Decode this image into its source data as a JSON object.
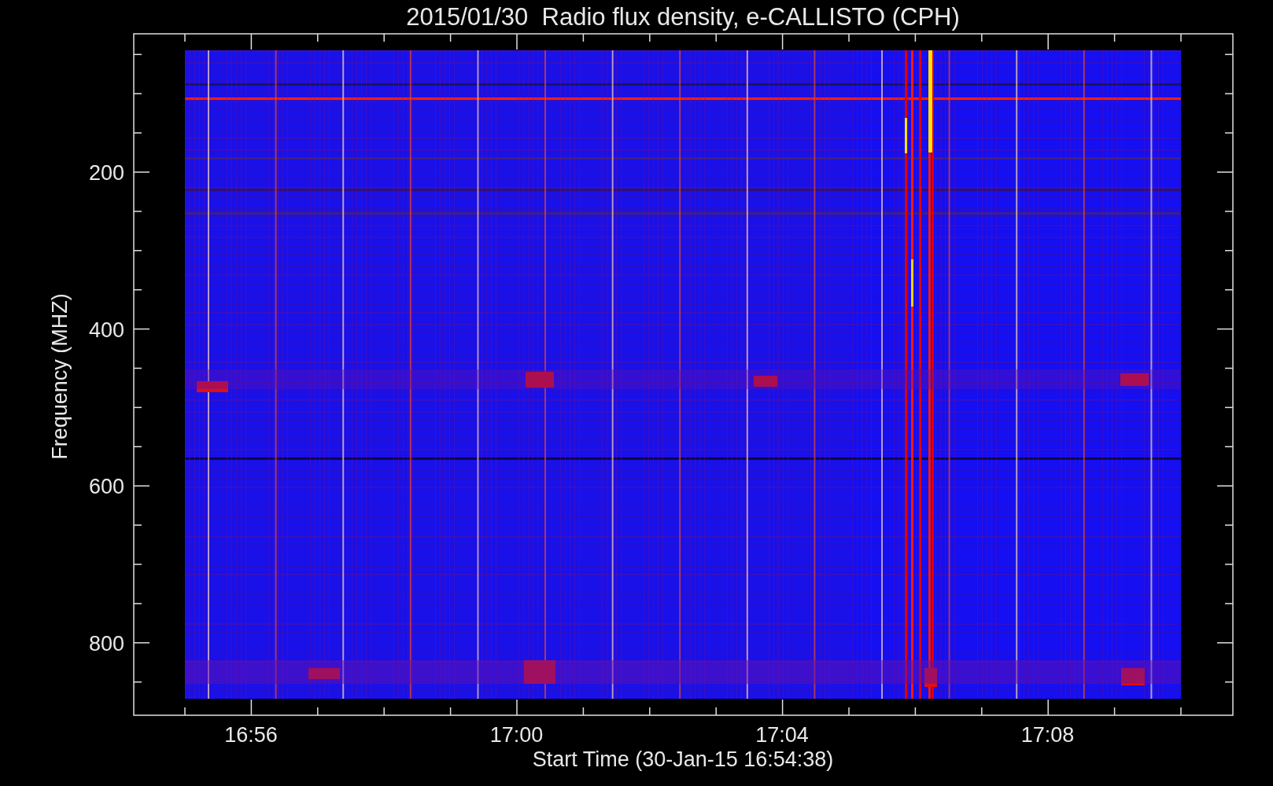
{
  "plot": {
    "title": "2015/01/30  Radio flux density, e-CALLISTO (CPH)",
    "xlabel": "Start Time (30-Jan-15 16:54:38)",
    "ylabel": "Frequency (MHZ)",
    "xtick_labels": [
      "16:56",
      "17:00",
      "17:04",
      "17:08"
    ],
    "ytick_labels": [
      "200",
      "400",
      "600",
      "800"
    ]
  }
}
